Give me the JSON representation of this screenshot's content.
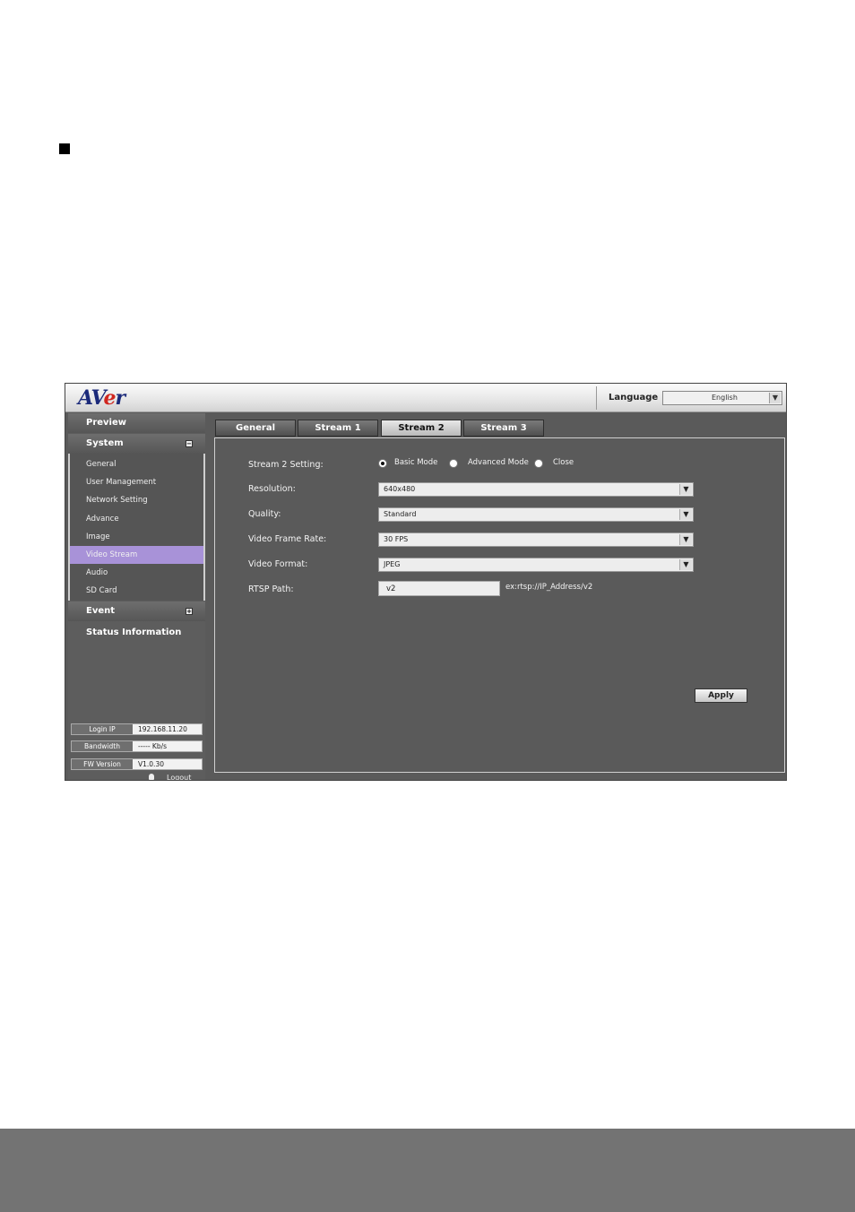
{
  "header": {
    "logo": {
      "pre": "AV",
      "accent": "e",
      "post": "r"
    },
    "language_label": "Language",
    "language_value": "English"
  },
  "sidebar": {
    "preview": "Preview",
    "system": "System",
    "system_items": [
      {
        "label": "General"
      },
      {
        "label": "User Management"
      },
      {
        "label": "Network Setting"
      },
      {
        "label": "Advance"
      },
      {
        "label": "Image"
      },
      {
        "label": "Video Stream",
        "active": true
      },
      {
        "label": "Audio"
      },
      {
        "label": "SD Card"
      }
    ],
    "event": "Event",
    "status": "Status Information",
    "info": {
      "login_ip_label": "Login IP",
      "login_ip": "192.168.11.20",
      "bandwidth_label": "Bandwidth",
      "bandwidth": "----- Kb/s",
      "fw_label": "FW Version",
      "fw": "V1.0.30"
    },
    "logout": "Logout"
  },
  "tabs": [
    "General",
    "Stream 1",
    "Stream 2",
    "Stream 3"
  ],
  "active_tab": "Stream 2",
  "form": {
    "setting_label": "Stream 2 Setting:",
    "modes": [
      "Basic Mode",
      "Advanced Mode",
      "Close"
    ],
    "selected_mode": "Basic Mode",
    "resolution_label": "Resolution:",
    "resolution": "640x480",
    "quality_label": "Quality:",
    "quality": "Standard",
    "frame_rate_label": "Video Frame Rate:",
    "frame_rate": "30 FPS",
    "format_label": "Video Format:",
    "format": "JPEG",
    "rtsp_label": "RTSP Path:",
    "rtsp": "v2",
    "rtsp_hint": "ex:rtsp://IP_Address/v2",
    "apply": "Apply"
  },
  "colors": {
    "active_menu": "#a892d8",
    "logo_blue": "#1b2a7a",
    "logo_red": "#d0261f"
  }
}
